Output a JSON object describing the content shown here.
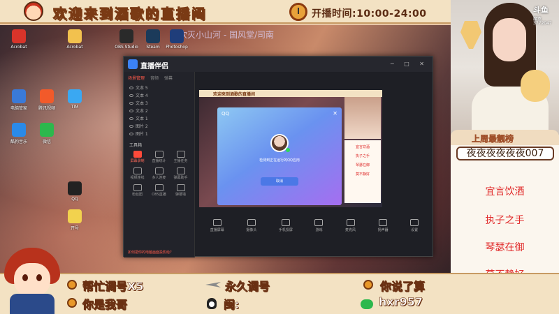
{
  "banner": {
    "welcome": "欢迎来到酒歌的直播间",
    "hours": "开播时间:10:00-24:00"
  },
  "desktop": {
    "title_overlay": "吹灭小山河 - 国风堂/司南",
    "icons": [
      {
        "label": "Acrobat",
        "color": "#d8342a"
      },
      {
        "label": "Acrobat",
        "color": "#f2c14e"
      },
      {
        "label": "OBS Studio",
        "color": "#2a2a2a"
      },
      {
        "label": "Steam",
        "color": "#1b3a5a"
      },
      {
        "label": "Photoshop",
        "color": "#1f3d7a"
      },
      {
        "label": "电脑管家",
        "color": "#3a7ad8"
      },
      {
        "label": "腾讯视频",
        "color": "#f25a2a"
      },
      {
        "label": "TIM",
        "color": "#3aa8f2"
      },
      {
        "label": "酷狗音乐",
        "color": "#2a8ae8"
      },
      {
        "label": "微信",
        "color": "#2db84d"
      },
      {
        "label": "QQ",
        "color": "#222222"
      },
      {
        "label": "开号",
        "color": "#f2d24e"
      }
    ]
  },
  "app": {
    "name": "直播伴侣",
    "sidebar_tabs": [
      "场景管理",
      "音频",
      "弹幕"
    ],
    "layers": [
      "文本 5",
      "文本 4",
      "文本 3",
      "文本 2",
      "文本 1",
      "图片 2",
      "图片 1"
    ],
    "tools_title": "工具箱",
    "tools": [
      {
        "label": "屏幕录制",
        "highlight": true
      },
      {
        "label": "直播统计",
        "highlight": false
      },
      {
        "label": "主播任务",
        "highlight": false
      },
      {
        "label": "视频连线",
        "highlight": false
      },
      {
        "label": "多人连麦",
        "highlight": false
      },
      {
        "label": "弹幕助手",
        "highlight": false
      },
      {
        "label": "粉丝团",
        "highlight": false
      },
      {
        "label": "OBS直播",
        "highlight": false
      },
      {
        "label": "弹幕墙",
        "highlight": false
      }
    ],
    "side_footer": "如何把你的电脑画面投影给?",
    "nested_banner": "欢迎来到酒歌的直播间",
    "nested_lyrics": [
      "宜言饮酒",
      "执子之手",
      "琴瑟在御",
      "莫不静好"
    ],
    "dialog": {
      "brand": "QQ",
      "message": "检测到正在运行的QQ应用",
      "cancel": "取消"
    },
    "toolbar": [
      "直播屏幕",
      "摄像头",
      "手机投屏",
      "游戏",
      "麦克风",
      "扬声器",
      "设置"
    ]
  },
  "bottom": {
    "item1_top": "帮忙调号X5",
    "item1_bottom": "你是我哥",
    "item2_top": "永久调号",
    "item2_bottom": "闽:",
    "item3_top": "你说了算",
    "item3_bottom": "hxr957"
  },
  "right": {
    "platform": "斗鱼",
    "platform_sub": "魔盒",
    "room_id": "3772047",
    "rank_title": "上周最靓榜",
    "top_user": "夜夜夜夜夜夜007",
    "lyrics": [
      "宜言饮酒",
      "执子之手",
      "琴瑟在御",
      "莫不静好"
    ]
  }
}
